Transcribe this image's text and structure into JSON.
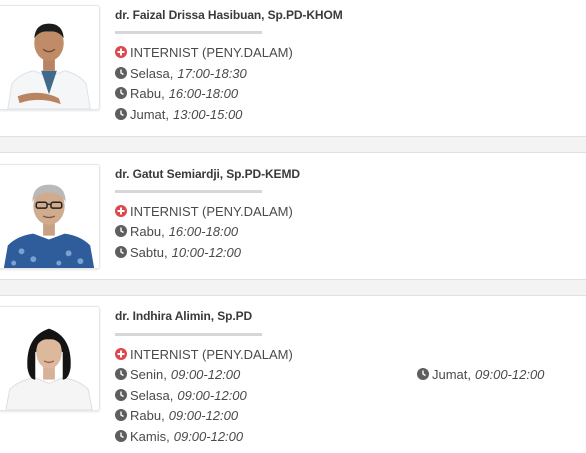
{
  "colors": {
    "specialty_icon": "#e0474c",
    "clock_icon": "#5e5e5e",
    "card_bg": "#ffffff",
    "page_bg": "#f3f3f4"
  },
  "doctors": [
    {
      "name": "dr. Faizal Drissa Hasibuan, Sp.PD-KHOM",
      "specialty": "INTERNIST (PENY.DALAM)",
      "schedule": [
        {
          "day": "Selasa,",
          "time": "17:00-18:30"
        },
        {
          "day": "Rabu,",
          "time": "16:00-18:00"
        },
        {
          "day": "Jumat,",
          "time": "13:00-15:00"
        }
      ]
    },
    {
      "name": "dr. Gatut Semiardji, Sp.PD-KEMD",
      "specialty": "INTERNIST (PENY.DALAM)",
      "schedule": [
        {
          "day": "Rabu,",
          "time": "16:00-18:00"
        },
        {
          "day": "Sabtu,",
          "time": "10:00-12:00"
        }
      ]
    },
    {
      "name": "dr. Indhira Alimin, Sp.PD",
      "specialty": "INTERNIST (PENY.DALAM)",
      "schedule": [
        {
          "day": "Senin,",
          "time": "09:00-12:00"
        },
        {
          "day": "Selasa,",
          "time": "09:00-12:00"
        },
        {
          "day": "Rabu,",
          "time": "09:00-12:00"
        },
        {
          "day": "Kamis,",
          "time": "09:00-12:00"
        },
        {
          "day": "Jumat,",
          "time": "09:00-12:00"
        }
      ]
    }
  ]
}
